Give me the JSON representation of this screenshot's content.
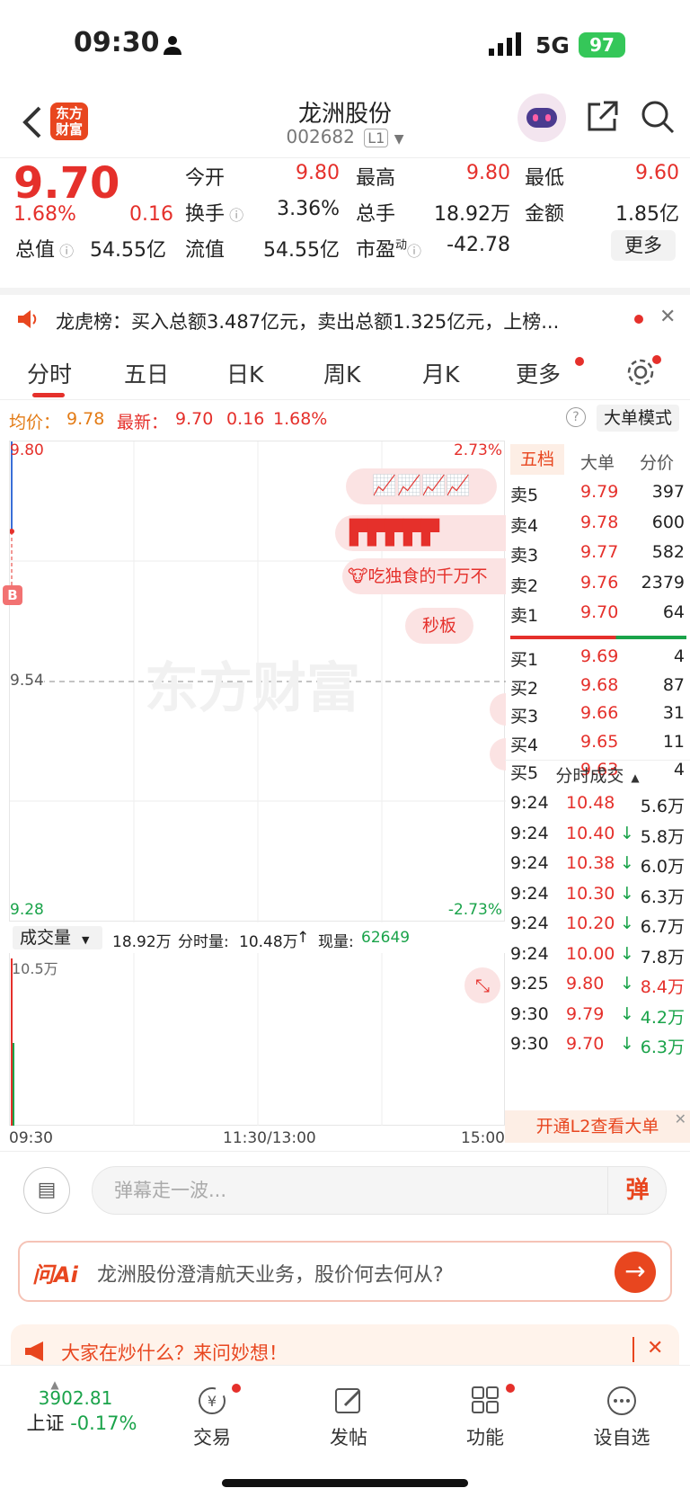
{
  "status": {
    "time": "09:30",
    "network": "5G",
    "battery": "97"
  },
  "nav": {
    "title": "龙洲股份",
    "code": "002682",
    "level": "L1",
    "logo": "东方财富"
  },
  "quote": {
    "price": "9.70",
    "pct": "1.68%",
    "change": "0.16",
    "open_label": "今开",
    "open": "9.80",
    "high_label": "最高",
    "high": "9.80",
    "low_label": "最低",
    "low": "9.60",
    "turnover_label": "换手",
    "turnover": "3.36%",
    "vol_label": "总手",
    "vol": "18.92万",
    "amount_label": "金额",
    "amount": "1.85亿",
    "mcap_label": "总值",
    "mcap": "54.55亿",
    "float_label": "流值",
    "float": "54.55亿",
    "pe_label": "市盈",
    "pe_sup": "动",
    "pe": "-42.78",
    "more": "更多"
  },
  "dragon": {
    "text": "龙虎榜：买入总额3.487亿元，卖出总额1.325亿元，上榜..."
  },
  "tabs": [
    "分时",
    "五日",
    "日K",
    "周K",
    "月K",
    "更多"
  ],
  "avg": {
    "avg_label": "均价：",
    "avg": "9.78",
    "latest_label": "最新：",
    "latest": "9.70",
    "chg": "0.16",
    "pct": "1.68%",
    "big_mode": "大单模式"
  },
  "chart": {
    "top_price": "9.80",
    "top_pct": "2.73%",
    "mid_price": "9.54",
    "bottom_price": "9.28",
    "bottom_pct": "-2.73%",
    "watermark": "东方财富",
    "bubble1": "吃独食的千万不",
    "bubble2": "秒板",
    "b_marker": "B"
  },
  "volbar": {
    "select": "成交量",
    "total": "18.92万",
    "fs_label": "分时量:",
    "fs": "10.48万",
    "arrow": "↑",
    "cur_label": "现量:",
    "cur": "62649",
    "max": "10.5万"
  },
  "xaxis": [
    "09:30",
    "11:30/13:00",
    "15:00"
  ],
  "book": {
    "tabs": [
      "五档",
      "大单",
      "分价"
    ],
    "asks": [
      {
        "l": "卖5",
        "p": "9.79",
        "v": "397"
      },
      {
        "l": "卖4",
        "p": "9.78",
        "v": "600"
      },
      {
        "l": "卖3",
        "p": "9.77",
        "v": "582"
      },
      {
        "l": "卖2",
        "p": "9.76",
        "v": "2379"
      },
      {
        "l": "卖1",
        "p": "9.70",
        "v": "64"
      }
    ],
    "bids": [
      {
        "l": "买1",
        "p": "9.69",
        "v": "4"
      },
      {
        "l": "买2",
        "p": "9.68",
        "v": "87"
      },
      {
        "l": "买3",
        "p": "9.66",
        "v": "31"
      },
      {
        "l": "买4",
        "p": "9.65",
        "v": "11"
      },
      {
        "l": "买5",
        "p": "9.63",
        "v": "4"
      }
    ],
    "trades_title": "分时成交",
    "trades": [
      {
        "t": "9:24",
        "p": "10.48",
        "a": "",
        "v": "5.6万"
      },
      {
        "t": "9:24",
        "p": "10.40",
        "a": "↓",
        "v": "5.8万"
      },
      {
        "t": "9:24",
        "p": "10.38",
        "a": "↓",
        "v": "6.0万"
      },
      {
        "t": "9:24",
        "p": "10.30",
        "a": "↓",
        "v": "6.3万"
      },
      {
        "t": "9:24",
        "p": "10.20",
        "a": "↓",
        "v": "6.7万"
      },
      {
        "t": "9:24",
        "p": "10.00",
        "a": "↓",
        "v": "7.8万"
      },
      {
        "t": "9:25",
        "p": "9.80",
        "a": "↓",
        "v": "8.4万"
      },
      {
        "t": "9:30",
        "p": "9.79",
        "a": "↓",
        "v": "4.2万"
      },
      {
        "t": "9:30",
        "p": "9.70",
        "a": "↓",
        "v": "6.3万"
      }
    ],
    "l2": "开通L2查看大单"
  },
  "danmu": {
    "placeholder": "弹幕走一波...",
    "btn": "弹"
  },
  "ai": {
    "logo": "问Ai",
    "text": "龙洲股份澄清航天业务，股价何去何从?"
  },
  "hot": {
    "text": "大家在炒什么？来问妙想！"
  },
  "bottom": {
    "index_value": "3902.81",
    "index_name": "上证",
    "index_pct": "-0.17%",
    "items": [
      "交易",
      "发帖",
      "功能",
      "设自选"
    ]
  },
  "colors": {
    "up": "#e5302b",
    "down": "#1aa34a",
    "accent": "#e8461f"
  }
}
